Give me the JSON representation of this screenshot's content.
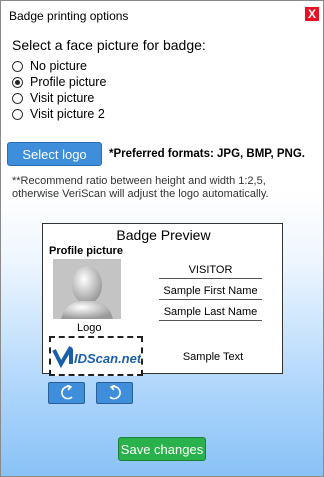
{
  "window": {
    "title": "Badge printing options",
    "close_label": "X"
  },
  "face": {
    "heading": "Select a face picture for badge:",
    "options": [
      {
        "label": "No picture",
        "checked": false
      },
      {
        "label": "Profile picture",
        "checked": true
      },
      {
        "label": "Visit picture",
        "checked": false
      },
      {
        "label": "Visit picture 2",
        "checked": false
      }
    ]
  },
  "logo": {
    "button_label": "Select logo",
    "formats_note": "*Preferred formats: JPG, BMP, PNG.",
    "ratio_note": "**Recommend ratio between height and width 1:2,5, otherwise VeriScan will adjust the logo automatically."
  },
  "preview": {
    "title": "Badge Preview",
    "profile_label": "Profile picture",
    "logo_label": "Logo",
    "logo_text": "IDScan.net",
    "fields": [
      "VISITOR",
      "Sample First Name",
      "Sample Last Name"
    ],
    "sample_text": "Sample Text"
  },
  "rotate": {
    "left_icon": "rotate-left-icon",
    "right_icon": "rotate-right-icon"
  },
  "save": {
    "label": "Save changes"
  },
  "colors": {
    "button_blue": "#3e8edb",
    "save_green": "#29b14b",
    "close_red": "#e81123"
  }
}
